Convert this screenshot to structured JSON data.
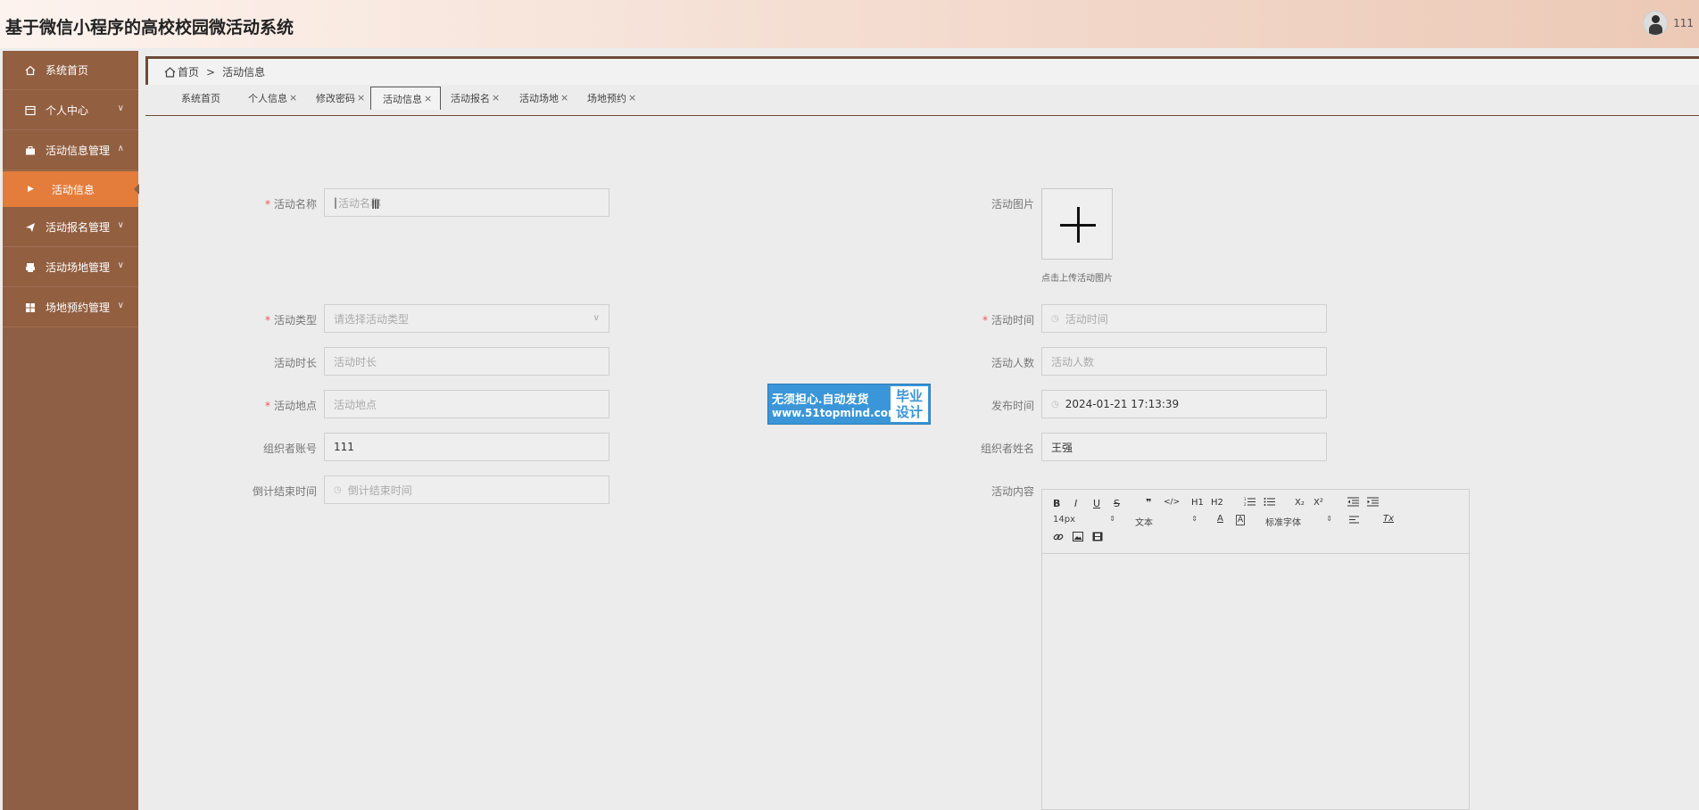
{
  "header": {
    "title": "基于微信小程序的高校校园微活动系统",
    "user_name": "111"
  },
  "sidebar": {
    "items": [
      {
        "label": "系统首页",
        "icon": "home-icon",
        "has_chevron": false
      },
      {
        "label": "个人中心",
        "icon": "profile-icon",
        "has_chevron": true
      },
      {
        "label": "活动信息管理",
        "icon": "briefcase-icon",
        "has_chevron": true,
        "expanded": true
      },
      {
        "label": "活动信息",
        "icon": "caret-right-icon",
        "sub": true,
        "active": true
      },
      {
        "label": "活动报名管理",
        "icon": "send-icon",
        "has_chevron": true
      },
      {
        "label": "活动场地管理",
        "icon": "printer-icon",
        "has_chevron": true
      },
      {
        "label": "场地预约管理",
        "icon": "grid-icon",
        "has_chevron": true
      }
    ]
  },
  "breadcrumb": {
    "home": "首页",
    "separator": ">",
    "current": "活动信息"
  },
  "tabs": [
    {
      "label": "系统首页",
      "closable": false
    },
    {
      "label": "个人信息",
      "closable": true
    },
    {
      "label": "修改密码",
      "closable": true
    },
    {
      "label": "活动信息",
      "closable": true,
      "active": true
    },
    {
      "label": "活动报名",
      "closable": true
    },
    {
      "label": "活动场地",
      "closable": true
    },
    {
      "label": "场地预约",
      "closable": true
    }
  ],
  "tab_close_glyph": "×",
  "form": {
    "name": {
      "label": "活动名称",
      "placeholder": "活动名称",
      "required": true
    },
    "image": {
      "label": "活动图片",
      "hint": "点击上传活动图片"
    },
    "type": {
      "label": "活动类型",
      "placeholder": "请选择活动类型",
      "required": true
    },
    "time": {
      "label": "活动时间",
      "placeholder": "活动时间",
      "required": true
    },
    "duration": {
      "label": "活动时长",
      "placeholder": "活动时长"
    },
    "people": {
      "label": "活动人数",
      "placeholder": "活动人数"
    },
    "location": {
      "label": "活动地点",
      "placeholder": "活动地点",
      "required": true
    },
    "publish_time": {
      "label": "发布时间",
      "value": "2024-01-21 17:13:39"
    },
    "organizer_account": {
      "label": "组织者账号",
      "value": "111"
    },
    "organizer_name": {
      "label": "组织者姓名",
      "value": "王强"
    },
    "countdown": {
      "label": "倒计结束时间",
      "placeholder": "倒计结束时间"
    },
    "content": {
      "label": "活动内容"
    }
  },
  "editor_toolbar": {
    "row1": [
      "B",
      "I",
      "U",
      "S",
      "❞",
      "</>",
      "H1",
      "H2",
      "ordered-list",
      "bullet-list",
      "X₂",
      "X²",
      "outdent",
      "indent"
    ],
    "font_size": "14px",
    "header_select": "文本",
    "font_family": "标准字体",
    "row2_icons": [
      "A",
      "A-bg",
      "align",
      "Tx"
    ],
    "row3_icons": [
      "link-icon",
      "image-icon",
      "video-icon"
    ]
  },
  "watermark": {
    "line1": "无须担心.自动发货",
    "line2": "www.51topmind.com",
    "right1": "毕业",
    "right2": "设计"
  },
  "colors": {
    "sidebar": "#8e5f44",
    "active_menu": "#e47c3c",
    "required": "#e55555",
    "watermark": "#3a96d8"
  }
}
